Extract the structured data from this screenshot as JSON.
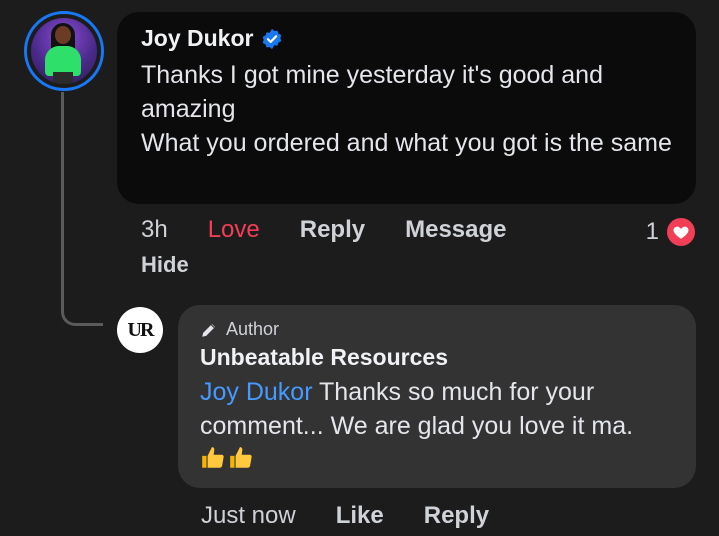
{
  "comment": {
    "author": "Joy Dukor",
    "verified_icon": "verified-badge-icon",
    "text": "Thanks I got mine yesterday it's good and amazing\nWhat you ordered and what you got is the same",
    "actions": {
      "time": "3h",
      "love": "Love",
      "reply": "Reply",
      "message": "Message",
      "hide": "Hide"
    },
    "reaction": {
      "count": "1",
      "icon": "heart-reaction-icon"
    },
    "colors": {
      "love": "#f33e58",
      "verified": "#1877f2"
    }
  },
  "reply": {
    "badge": "Author",
    "badge_icon": "pen-icon",
    "avatar_text": "UR",
    "author": "Unbeatable Resources",
    "mention": "Joy Dukor",
    "text": " Thanks so much for your comment... We are glad you love it ma.",
    "emoji": [
      "thumbs-up-icon",
      "thumbs-up-icon"
    ],
    "actions": {
      "time": "Just now",
      "like": "Like",
      "reply": "Reply"
    },
    "colors": {
      "mention": "#4599ff"
    }
  }
}
